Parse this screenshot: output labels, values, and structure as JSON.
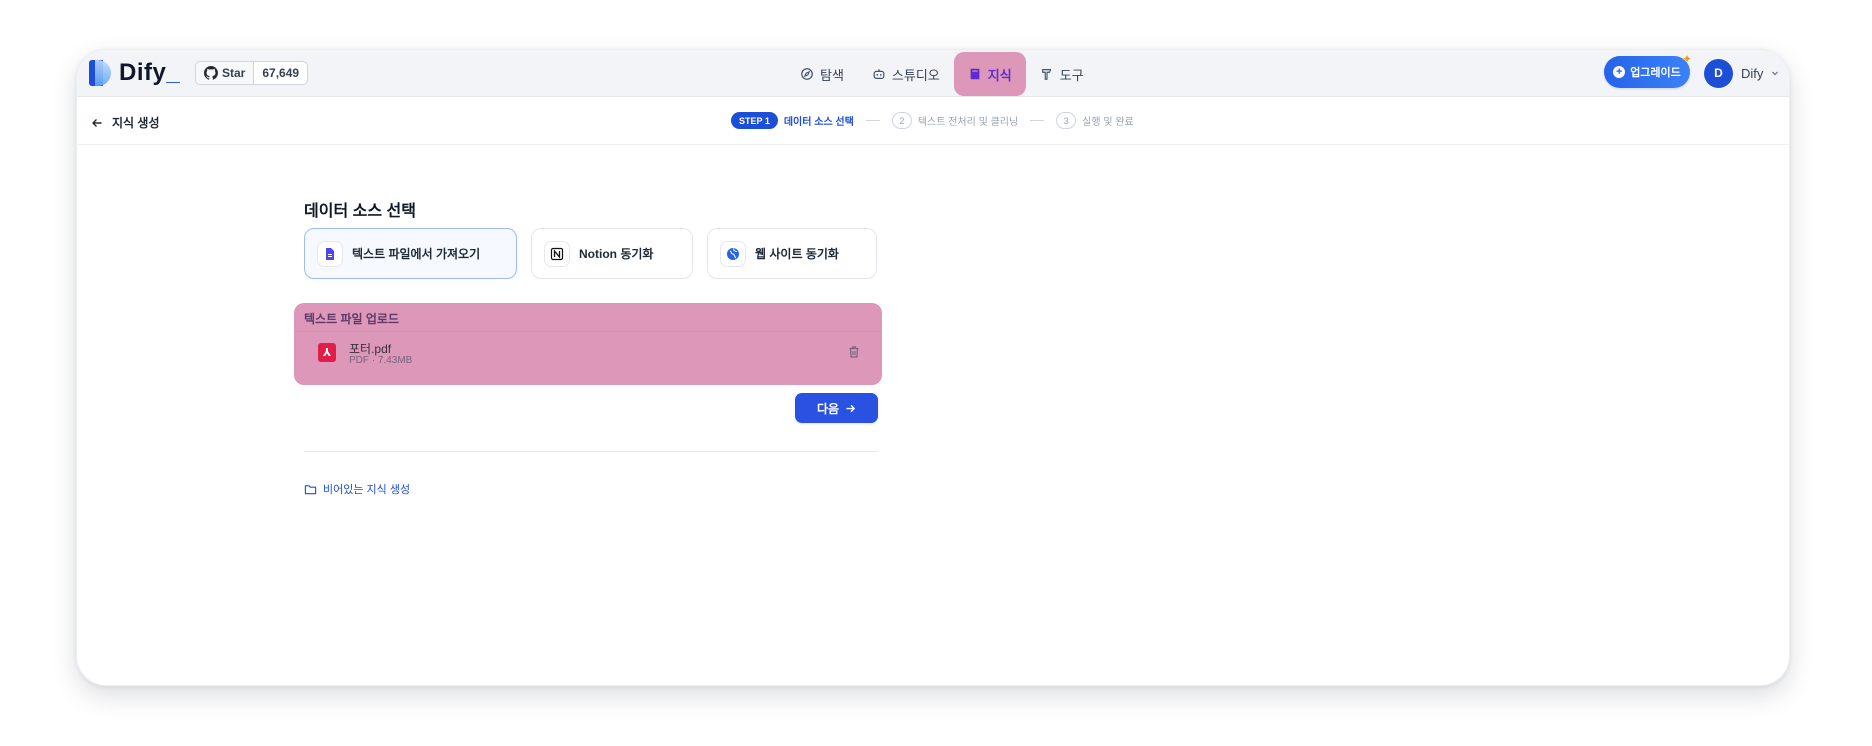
{
  "brand": {
    "name": "Dify",
    "accent": "#1d4ed8"
  },
  "github": {
    "star_label": "Star",
    "count": "67,649"
  },
  "nav": {
    "items": [
      {
        "label": "탐색",
        "icon": "compass-icon"
      },
      {
        "label": "스튜디오",
        "icon": "robot-icon"
      },
      {
        "label": "지식",
        "icon": "book-icon",
        "active": true
      },
      {
        "label": "도구",
        "icon": "hammer-icon"
      }
    ]
  },
  "header": {
    "upgrade_label": "업그레이드",
    "avatar_initial": "D",
    "account_name": "Dify"
  },
  "stepbar": {
    "back_label": "지식 생성",
    "step1_badge": "STEP 1",
    "step1_label": "데이터 소스 선택",
    "step2_num": "2",
    "step2_label": "텍스트 전처리 및 클리닝",
    "step3_num": "3",
    "step3_label": "실행 및 완료"
  },
  "main": {
    "section_title": "데이터 소스 선택",
    "sources": [
      {
        "label": "텍스트 파일에서 가져오기",
        "icon": "document-icon",
        "selected": true
      },
      {
        "label": "Notion 동기화",
        "icon": "notion-icon"
      },
      {
        "label": "웹 사이트 동기화",
        "icon": "globe-icon"
      }
    ],
    "upload": {
      "title": "텍스트 파일 업로드",
      "file_name": "포터.pdf",
      "file_meta": "PDF · 7.43MB"
    },
    "next_label": "다음",
    "empty_link_label": "비어있는 지식 생성"
  }
}
